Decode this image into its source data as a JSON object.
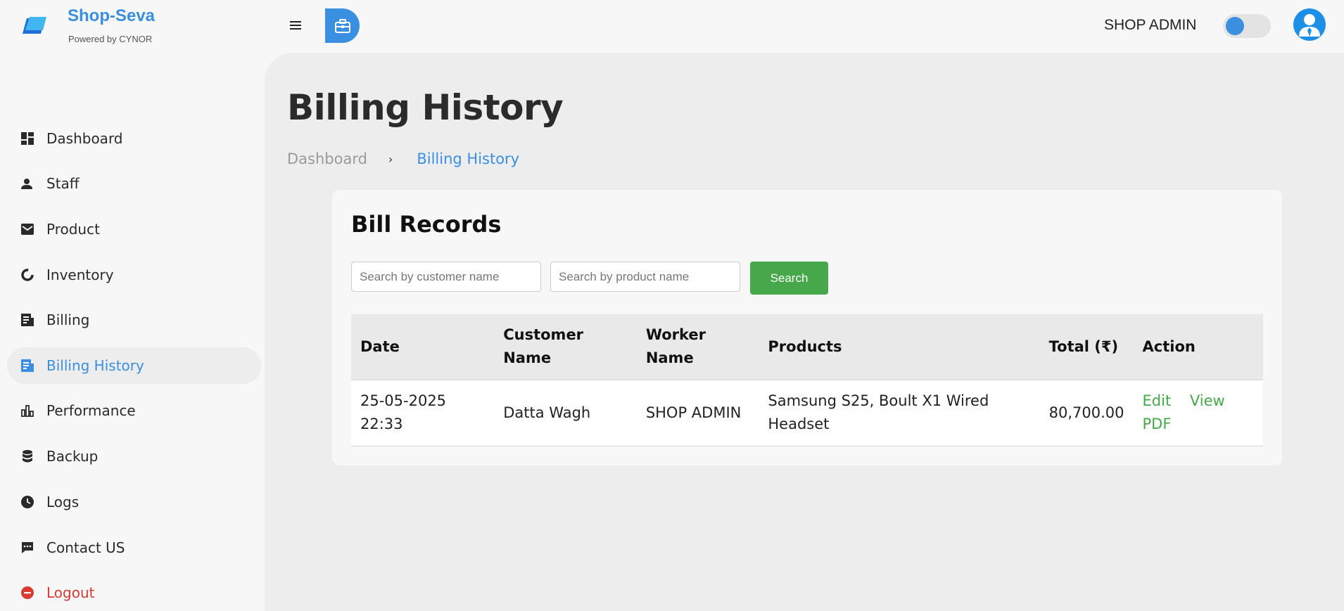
{
  "brand": {
    "name": "Shop-Seva",
    "subtitle": "Powered by CYNOR",
    "accent_color": "#3b8fe0"
  },
  "header": {
    "user_role": "SHOP ADMIN",
    "theme_toggle": {
      "on": false
    },
    "icons": [
      "hamburger-menu-icon",
      "briefcase-icon",
      "user-avatar-icon"
    ]
  },
  "sidebar": {
    "items": [
      {
        "label": "Dashboard",
        "icon": "dashboard-grid-icon",
        "active": false
      },
      {
        "label": "Staff",
        "icon": "person-icon",
        "active": false
      },
      {
        "label": "Product",
        "icon": "envelope-box-icon",
        "active": false
      },
      {
        "label": "Inventory",
        "icon": "donut-chart-icon",
        "active": false
      },
      {
        "label": "Billing",
        "icon": "receipt-icon",
        "active": false
      },
      {
        "label": "Billing History",
        "icon": "receipt-icon",
        "active": true
      },
      {
        "label": "Performance",
        "icon": "bar-chart-icon",
        "active": false
      },
      {
        "label": "Backup",
        "icon": "database-icon",
        "active": false
      },
      {
        "label": "Logs",
        "icon": "clock-icon",
        "active": false
      },
      {
        "label": "Contact US",
        "icon": "chat-icon",
        "active": false
      },
      {
        "label": "Logout",
        "icon": "logout-icon",
        "active": false,
        "color": "#d83a34"
      }
    ]
  },
  "page": {
    "title": "Billing History",
    "breadcrumb": {
      "home": "Dashboard",
      "separator": "›",
      "current": "Billing History"
    }
  },
  "card": {
    "title": "Bill Records",
    "search": {
      "customer_placeholder": "Search by customer name",
      "product_placeholder": "Search by product name",
      "button_label": "Search",
      "button_color": "#46a84a"
    },
    "table": {
      "headers": {
        "date": "Date",
        "customer_line1": "Customer",
        "customer_line2": "Name",
        "worker_line1": "Worker",
        "worker_line2": "Name",
        "products": "Products",
        "total": "Total (₹)",
        "action": "Action"
      },
      "rows": [
        {
          "date_line1": "25-05-2025",
          "date_line2": "22:33",
          "customer": "Datta Wagh",
          "worker": "SHOP ADMIN",
          "products_line1": "Samsung S25, Boult X1 Wired",
          "products_line2": "Headset",
          "total": "80,700.00",
          "actions": {
            "edit": "Edit",
            "view_line1": "View",
            "view_line2": "PDF"
          }
        }
      ]
    }
  }
}
